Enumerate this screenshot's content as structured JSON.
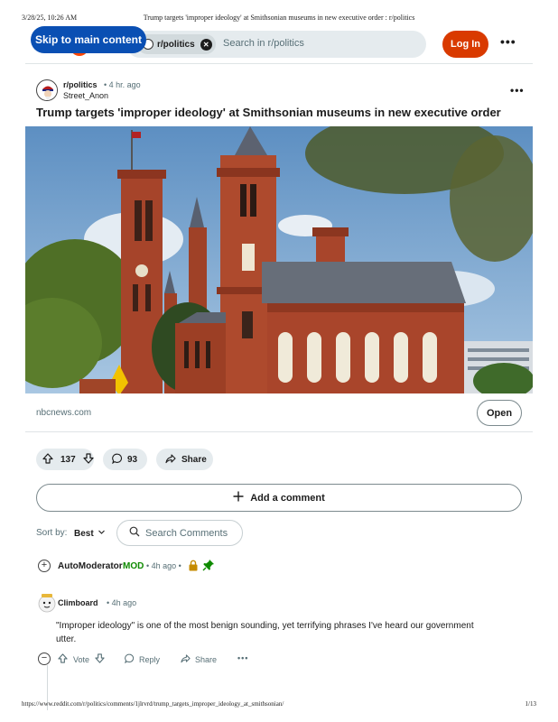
{
  "print": {
    "date": "3/28/25, 10:26 AM",
    "title": "Trump targets 'improper ideology' at Smithsonian museums in new executive order : r/politics",
    "url": "https://www.reddit.com/r/politics/comments/1jlrvrd/trump_targets_improper_ideology_at_smithsonian/",
    "page": "1/13"
  },
  "header": {
    "skip_label": "Skip to main content",
    "subreddit_chip": "r/politics",
    "search_placeholder": "Search in r/politics",
    "login_label": "Log In",
    "more_label": "•••",
    "brand_color": "#ff4500"
  },
  "post": {
    "subreddit": "r/politics",
    "time": "• 4 hr. ago",
    "author": "Street_Anon",
    "more_label": "•••",
    "title": "Trump targets 'improper ideology' at Smithsonian museums in new executive order",
    "image_icon": "smithsonian-castle-photo",
    "link_domain": "nbcnews.com",
    "open_label": "Open",
    "votes": "137",
    "comments": "93",
    "share_label": "Share"
  },
  "comments_section": {
    "add_comment_label": "Add a comment",
    "sort_label": "Sort by:",
    "sort_value": "Best",
    "search_placeholder": "Search Comments"
  },
  "comments": [
    {
      "author": "AutoModerator",
      "tag": "MOD",
      "time": "• 4h ago •",
      "locked_icon": "lock-icon",
      "pinned_icon": "pin-icon"
    },
    {
      "author": "Climboard",
      "time": "• 4h ago",
      "body": "\"Improper ideology\" is one of the most benign sounding, yet terrifying phrases I've heard our government utter.",
      "vote_label": "Vote",
      "reply_label": "Reply",
      "share_label": "Share",
      "more_label": "•••"
    }
  ]
}
